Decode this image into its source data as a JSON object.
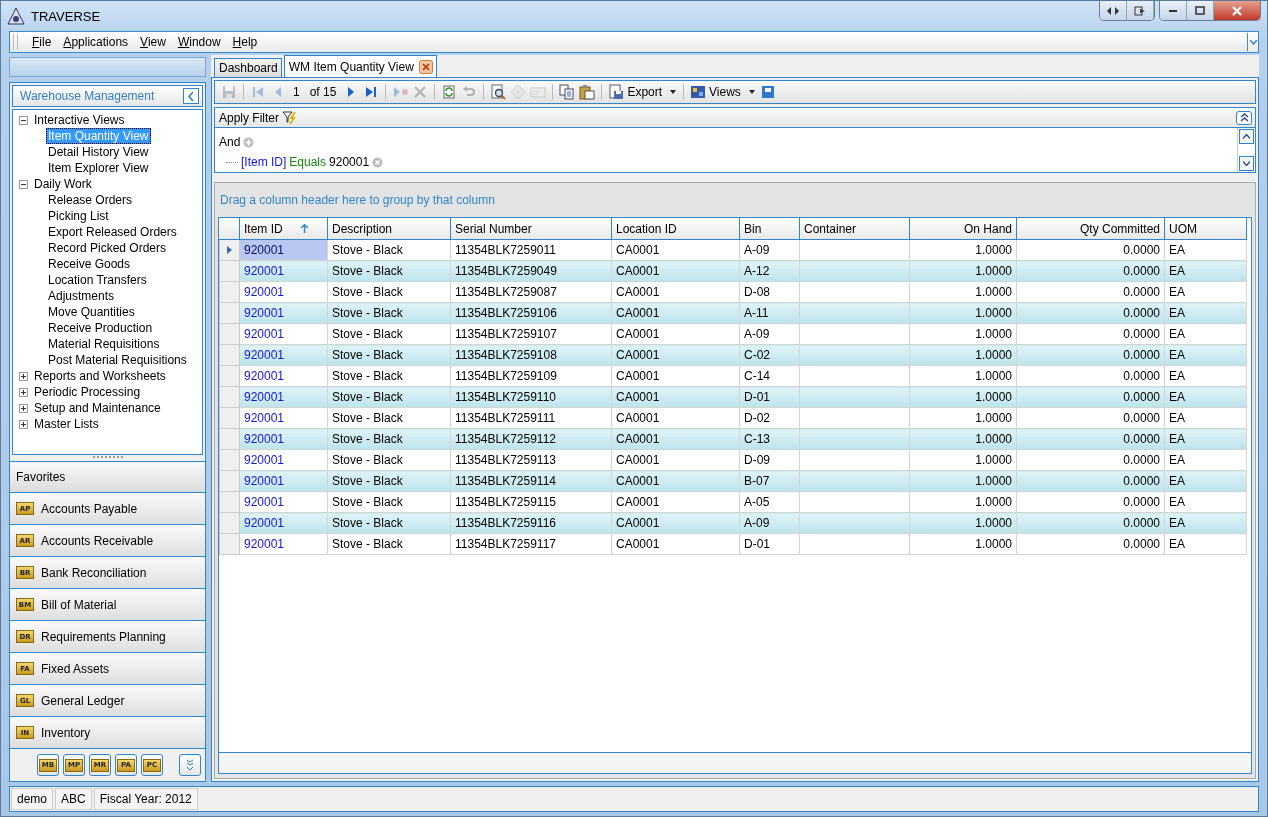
{
  "window": {
    "title": "TRAVERSE"
  },
  "menu": [
    "File",
    "Applications",
    "View",
    "Window",
    "Help"
  ],
  "sidebar": {
    "header": "Warehouse Management",
    "tree": [
      {
        "label": "Interactive Views",
        "expanded": true,
        "children": [
          {
            "label": "Item Quantity View",
            "selected": true
          },
          {
            "label": "Detail History View",
            "selected": false
          },
          {
            "label": "Item Explorer View",
            "selected": false
          }
        ]
      },
      {
        "label": "Daily Work",
        "expanded": true,
        "children": [
          {
            "label": "Release Orders",
            "selected": false
          },
          {
            "label": "Picking List",
            "selected": false
          },
          {
            "label": "Export Released Orders",
            "selected": false
          },
          {
            "label": "Record Picked Orders",
            "selected": false
          },
          {
            "label": "Receive Goods",
            "selected": false
          },
          {
            "label": "Location Transfers",
            "selected": false
          },
          {
            "label": "Adjustments",
            "selected": false
          },
          {
            "label": "Move Quantities",
            "selected": false
          },
          {
            "label": "Receive Production",
            "selected": false
          },
          {
            "label": "Material Requisitions",
            "selected": false
          },
          {
            "label": "Post Material Requisitions",
            "selected": false
          }
        ]
      },
      {
        "label": "Reports and Worksheets",
        "expanded": false
      },
      {
        "label": "Periodic Processing",
        "expanded": false
      },
      {
        "label": "Setup and Maintenance",
        "expanded": false
      },
      {
        "label": "Master Lists",
        "expanded": false
      }
    ],
    "favorites": "Favorites",
    "modules": [
      {
        "code": "AP",
        "label": "Accounts Payable"
      },
      {
        "code": "AR",
        "label": "Accounts Receivable"
      },
      {
        "code": "BR",
        "label": "Bank Reconciliation"
      },
      {
        "code": "BM",
        "label": "Bill of Material"
      },
      {
        "code": "DR",
        "label": "Requirements Planning"
      },
      {
        "code": "FA",
        "label": "Fixed Assets"
      },
      {
        "code": "GL",
        "label": "General Ledger"
      },
      {
        "code": "IN",
        "label": "Inventory"
      }
    ],
    "more_modules": [
      "MB",
      "MP",
      "MR",
      "PA",
      "PC"
    ]
  },
  "tabs": [
    {
      "label": "Dashboard",
      "selected": false,
      "closable": false
    },
    {
      "label": "WM Item Quantity View",
      "selected": true,
      "closable": true
    }
  ],
  "toolbar": {
    "groups": [
      [
        {
          "kind": "save",
          "disabled": true
        }
      ],
      [
        {
          "kind": "first",
          "disabled": true
        },
        {
          "kind": "prev",
          "disabled": true
        },
        {
          "kind": "text",
          "text": "1"
        },
        {
          "kind": "text",
          "text": "of 15"
        },
        {
          "kind": "next",
          "disabled": false
        },
        {
          "kind": "last",
          "disabled": false
        }
      ],
      [
        {
          "kind": "append",
          "disabled": true
        },
        {
          "kind": "delete",
          "disabled": true
        }
      ],
      [
        {
          "kind": "refresh",
          "disabled": false
        },
        {
          "kind": "undo",
          "disabled": true
        }
      ],
      [
        {
          "kind": "preview",
          "disabled": false
        },
        {
          "kind": "tag",
          "disabled": true
        },
        {
          "kind": "mail",
          "disabled": true
        }
      ],
      [
        {
          "kind": "copy",
          "disabled": false
        },
        {
          "kind": "paste",
          "disabled": false
        }
      ],
      [
        {
          "kind": "export",
          "text": "Export"
        }
      ],
      [
        {
          "kind": "views",
          "text": "Views"
        },
        {
          "kind": "pin",
          "disabled": false
        }
      ]
    ]
  },
  "filter": {
    "title": "Apply Filter",
    "root": "And",
    "conditions": [
      {
        "field": "[Item ID]",
        "operator": "Equals",
        "value": "920001"
      }
    ]
  },
  "grid": {
    "group_hint": "Drag a column header here to group by that column",
    "columns": [
      {
        "label": "Item ID",
        "kind": "text",
        "sorted": true
      },
      {
        "label": "Description",
        "kind": "text",
        "sorted": false
      },
      {
        "label": "Serial Number",
        "kind": "text",
        "sorted": false
      },
      {
        "label": "Location ID",
        "kind": "text",
        "sorted": false
      },
      {
        "label": "Bin",
        "kind": "text",
        "sorted": false
      },
      {
        "label": "Container",
        "kind": "text",
        "sorted": false
      },
      {
        "label": "On Hand",
        "kind": "number",
        "sorted": false
      },
      {
        "label": "Qty Committed",
        "kind": "number",
        "sorted": false
      },
      {
        "label": "UOM",
        "kind": "text",
        "sorted": false
      }
    ],
    "rows": [
      {
        "selected": true,
        "cells": [
          "920001",
          "Stove - Black",
          "11354BLK7259011",
          "CA0001",
          "A-09",
          "",
          "1.0000",
          "0.0000",
          "EA"
        ]
      },
      {
        "selected": false,
        "cells": [
          "920001",
          "Stove - Black",
          "11354BLK7259049",
          "CA0001",
          "A-12",
          "",
          "1.0000",
          "0.0000",
          "EA"
        ]
      },
      {
        "selected": false,
        "cells": [
          "920001",
          "Stove - Black",
          "11354BLK7259087",
          "CA0001",
          "D-08",
          "",
          "1.0000",
          "0.0000",
          "EA"
        ]
      },
      {
        "selected": false,
        "cells": [
          "920001",
          "Stove - Black",
          "11354BLK7259106",
          "CA0001",
          "A-11",
          "",
          "1.0000",
          "0.0000",
          "EA"
        ]
      },
      {
        "selected": false,
        "cells": [
          "920001",
          "Stove - Black",
          "11354BLK7259107",
          "CA0001",
          "A-09",
          "",
          "1.0000",
          "0.0000",
          "EA"
        ]
      },
      {
        "selected": false,
        "cells": [
          "920001",
          "Stove - Black",
          "11354BLK7259108",
          "CA0001",
          "C-02",
          "",
          "1.0000",
          "0.0000",
          "EA"
        ]
      },
      {
        "selected": false,
        "cells": [
          "920001",
          "Stove - Black",
          "11354BLK7259109",
          "CA0001",
          "C-14",
          "",
          "1.0000",
          "0.0000",
          "EA"
        ]
      },
      {
        "selected": false,
        "cells": [
          "920001",
          "Stove - Black",
          "11354BLK7259110",
          "CA0001",
          "D-01",
          "",
          "1.0000",
          "0.0000",
          "EA"
        ]
      },
      {
        "selected": false,
        "cells": [
          "920001",
          "Stove - Black",
          "11354BLK7259111",
          "CA0001",
          "D-02",
          "",
          "1.0000",
          "0.0000",
          "EA"
        ]
      },
      {
        "selected": false,
        "cells": [
          "920001",
          "Stove - Black",
          "11354BLK7259112",
          "CA0001",
          "C-13",
          "",
          "1.0000",
          "0.0000",
          "EA"
        ]
      },
      {
        "selected": false,
        "cells": [
          "920001",
          "Stove - Black",
          "11354BLK7259113",
          "CA0001",
          "D-09",
          "",
          "1.0000",
          "0.0000",
          "EA"
        ]
      },
      {
        "selected": false,
        "cells": [
          "920001",
          "Stove - Black",
          "11354BLK7259114",
          "CA0001",
          "B-07",
          "",
          "1.0000",
          "0.0000",
          "EA"
        ]
      },
      {
        "selected": false,
        "cells": [
          "920001",
          "Stove - Black",
          "11354BLK7259115",
          "CA0001",
          "A-05",
          "",
          "1.0000",
          "0.0000",
          "EA"
        ]
      },
      {
        "selected": false,
        "cells": [
          "920001",
          "Stove - Black",
          "11354BLK7259116",
          "CA0001",
          "A-09",
          "",
          "1.0000",
          "0.0000",
          "EA"
        ]
      },
      {
        "selected": false,
        "cells": [
          "920001",
          "Stove - Black",
          "11354BLK7259117",
          "CA0001",
          "D-01",
          "",
          "1.0000",
          "0.0000",
          "EA"
        ]
      }
    ]
  },
  "status_bar": [
    "demo",
    "ABC",
    "Fiscal Year: 2012"
  ]
}
